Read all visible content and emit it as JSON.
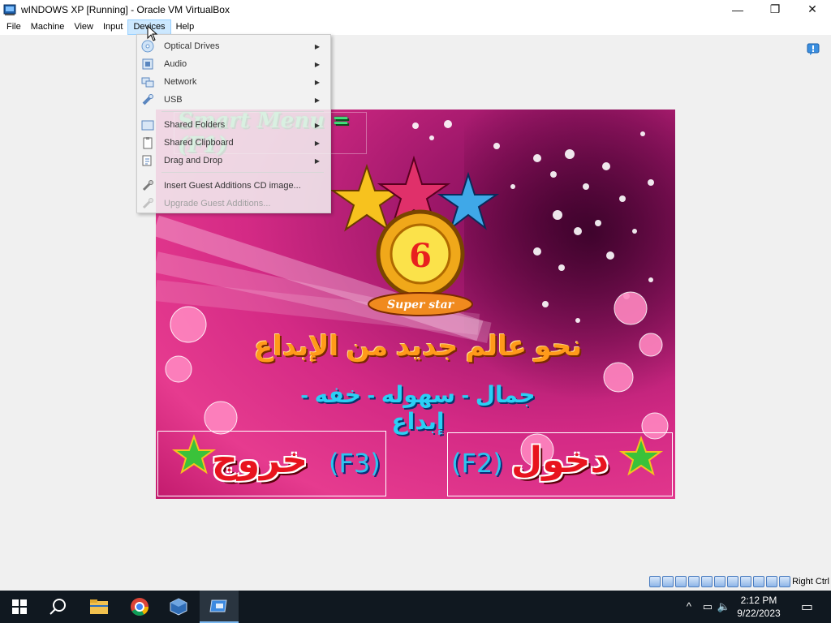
{
  "window": {
    "title": "wINDOWS XP [Running] - Oracle VM VirtualBox",
    "minimize_glyph": "—",
    "maximize_glyph": "❐",
    "close_glyph": "✕"
  },
  "menubar": {
    "items": [
      {
        "label": "File"
      },
      {
        "label": "Machine"
      },
      {
        "label": "View"
      },
      {
        "label": "Input"
      },
      {
        "label": "Devices",
        "active": true
      },
      {
        "label": "Help"
      }
    ]
  },
  "devices_menu": {
    "items": [
      {
        "label": "Optical Drives",
        "icon": "optical-drive-icon",
        "submenu": true,
        "disabled": false
      },
      {
        "label": "Audio",
        "icon": "audio-icon",
        "submenu": true,
        "disabled": false
      },
      {
        "label": "Network",
        "icon": "network-icon",
        "submenu": true,
        "disabled": false
      },
      {
        "label": "USB",
        "icon": "usb-icon",
        "submenu": true,
        "disabled": false
      },
      {
        "label": "Shared Folders",
        "icon": "shared-folders-icon",
        "submenu": true,
        "disabled": false
      },
      {
        "label": "Shared Clipboard",
        "icon": "shared-clipboard-icon",
        "submenu": true,
        "disabled": false
      },
      {
        "label": "Drag and Drop",
        "icon": "drag-drop-icon",
        "submenu": true,
        "disabled": false
      },
      {
        "label": "Insert Guest Additions CD image...",
        "icon": "guest-additions-icon",
        "submenu": false,
        "disabled": false
      },
      {
        "label": "Upgrade Guest Additions...",
        "icon": "upgrade-guest-additions-icon",
        "submenu": false,
        "disabled": true
      }
    ],
    "submenu_arrow": "▶"
  },
  "guest_screen": {
    "smart_menu_text": "Smart Menu = (F1)",
    "badge_number": "6",
    "badge_text": "Super star",
    "headline_ar": "نحو عالم جديد من الإبداع",
    "subline_ar": "جمال - سهوله - خفه - إبداع",
    "exit_key": "(F3)",
    "exit_word": "خروج",
    "enter_key": "(F2)",
    "enter_word": "دخول"
  },
  "statusbar": {
    "host_key_label": "Right Ctrl",
    "icons": [
      "hard-disk-icon",
      "optical-drive-icon",
      "audio-icon",
      "network-icon",
      "usb-icon",
      "shared-folders-icon",
      "display-icon",
      "video-capture-icon",
      "virtualization-icon",
      "mouse-integration-icon",
      "keyboard-icon"
    ]
  },
  "taskbar": {
    "apps": [
      {
        "name": "start-button",
        "active": false
      },
      {
        "name": "search-button",
        "active": false
      },
      {
        "name": "file-explorer-button",
        "active": false
      },
      {
        "name": "chrome-button",
        "active": false
      },
      {
        "name": "virtualbox-manager-button",
        "active": false
      },
      {
        "name": "vm-window-button",
        "active": true
      }
    ],
    "clock_time": "2:12 PM",
    "clock_date": "9/22/2023"
  },
  "colors": {
    "accent": "#cce8ff",
    "taskbar_bg": "#101820",
    "guest_pink": "#e63b8f"
  }
}
